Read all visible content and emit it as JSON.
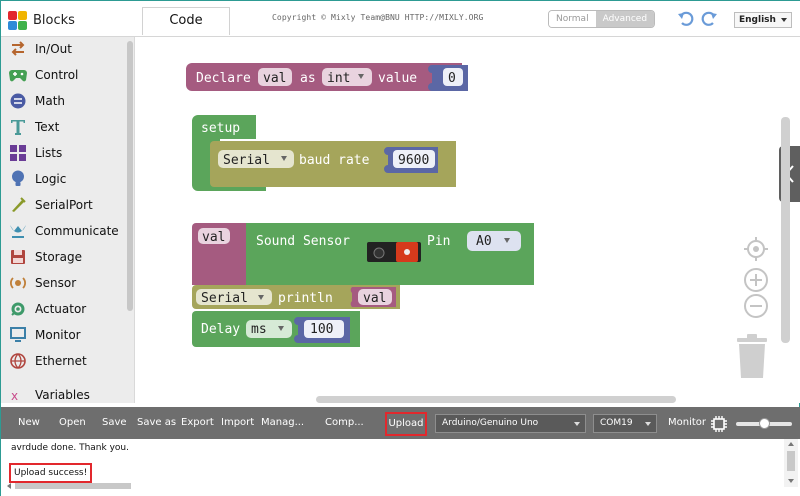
{
  "header": {
    "blocks_tab": "Blocks",
    "code_tab": "Code",
    "copyright": "Copyright © Mixly Team@BNU HTTP://MIXLY.ORG",
    "mode_normal": "Normal",
    "mode_advanced": "Advanced",
    "language": "English"
  },
  "sidebar": {
    "items": [
      {
        "label": "In/Out",
        "icon": "in-out-icon",
        "color": "#b5652d"
      },
      {
        "label": "Control",
        "icon": "gamepad-icon",
        "color": "#45a054"
      },
      {
        "label": "Math",
        "icon": "math-icon",
        "color": "#4a5ba4"
      },
      {
        "label": "Text",
        "icon": "text-icon",
        "color": "#4a9a98"
      },
      {
        "label": "Lists",
        "icon": "lists-icon",
        "color": "#6a3c96"
      },
      {
        "label": "Logic",
        "icon": "bulb-icon",
        "color": "#4f73b4"
      },
      {
        "label": "SerialPort",
        "icon": "serialport-icon",
        "color": "#8a9a2a"
      },
      {
        "label": "Communicate",
        "icon": "communicate-icon",
        "color": "#3e8fb0"
      },
      {
        "label": "Storage",
        "icon": "storage-icon",
        "color": "#b0453e"
      },
      {
        "label": "Sensor",
        "icon": "sensor-icon",
        "color": "#c0803a"
      },
      {
        "label": "Actuator",
        "icon": "actuator-icon",
        "color": "#3e9a6a"
      },
      {
        "label": "Monitor",
        "icon": "monitor-icon",
        "color": "#3c80a8"
      },
      {
        "label": "Ethernet",
        "icon": "ethernet-icon",
        "color": "#b0453e"
      },
      {
        "label": "Variables",
        "icon": "variables-icon",
        "color": "#c84a8a"
      }
    ]
  },
  "blocks": {
    "declare": {
      "keyword": "Declare",
      "var": "val",
      "as": "as",
      "type": "int",
      "value_label": "value",
      "value": "0"
    },
    "setup": {
      "label": "setup",
      "serial": "Serial",
      "baud_label": "baud rate",
      "baud": "9600"
    },
    "sound": {
      "var": "val",
      "label": "Sound Sensor",
      "pin_label": "Pin",
      "pin": "A0"
    },
    "println": {
      "serial": "Serial",
      "label": "println",
      "var": "val"
    },
    "delay": {
      "label": "Delay",
      "unit": "ms",
      "value": "100"
    }
  },
  "colors": {
    "declare": "#a55b80",
    "setup": "#5ba55b",
    "serial": "#a5a55b",
    "number": "#5b67a5",
    "field_bg": "#f0f0f0"
  },
  "toolbar": {
    "new": "New",
    "open": "Open",
    "save": "Save",
    "save_as": "Save as",
    "export": "Export",
    "import": "Import",
    "manage": "Manag...",
    "compile": "Comp...",
    "upload": "Upload",
    "board": "Arduino/Genuino Uno",
    "port": "COM19",
    "monitor": "Monitor"
  },
  "console": {
    "line1": "avrdude done.  Thank you.",
    "line2": "Upload success!"
  }
}
